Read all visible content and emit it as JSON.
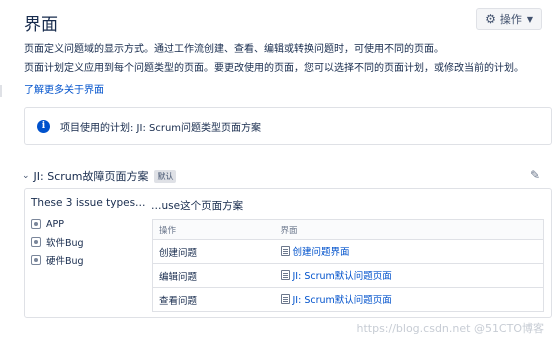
{
  "page": {
    "title": "界面",
    "operations_button": {
      "label": "操作",
      "icon": "gear-icon"
    },
    "description_line1": "页面定义问题域的显示方式。通过工作流创建、查看、编辑或转换问题时，可使用不同的页面。",
    "description_line2": "页面计划定义应用到每个问题类型的页面。要更改使用的页面，您可以选择不同的页面计划，或修改当前的计划。",
    "learn_more_link": "了解更多关于界面"
  },
  "info_box": {
    "icon": "info-icon",
    "text": "项目使用的计划: JI: Scrum问题类型页面方案"
  },
  "scheme": {
    "name": "JI: Scrum故障页面方案",
    "default_badge": "默认",
    "issue_types_title": "These 3 issue types…",
    "issue_types": [
      {
        "label": "APP",
        "icon": "issue-type-icon"
      },
      {
        "label": "软件Bug",
        "icon": "issue-type-icon"
      },
      {
        "label": "硬件Bug",
        "icon": "issue-type-icon"
      }
    ],
    "use_title": "…use这个页面方案",
    "table": {
      "headers": [
        "操作",
        "界面"
      ],
      "rows": [
        {
          "operation": "创建问题",
          "screen": "创建问题界面"
        },
        {
          "operation": "编辑问题",
          "screen": "JI: Scrum默认问题页面"
        },
        {
          "operation": "查看问题",
          "screen": "JI: Scrum默认问题页面"
        }
      ]
    }
  },
  "watermark": "https://blog.csdn.net  @51CTO博客"
}
